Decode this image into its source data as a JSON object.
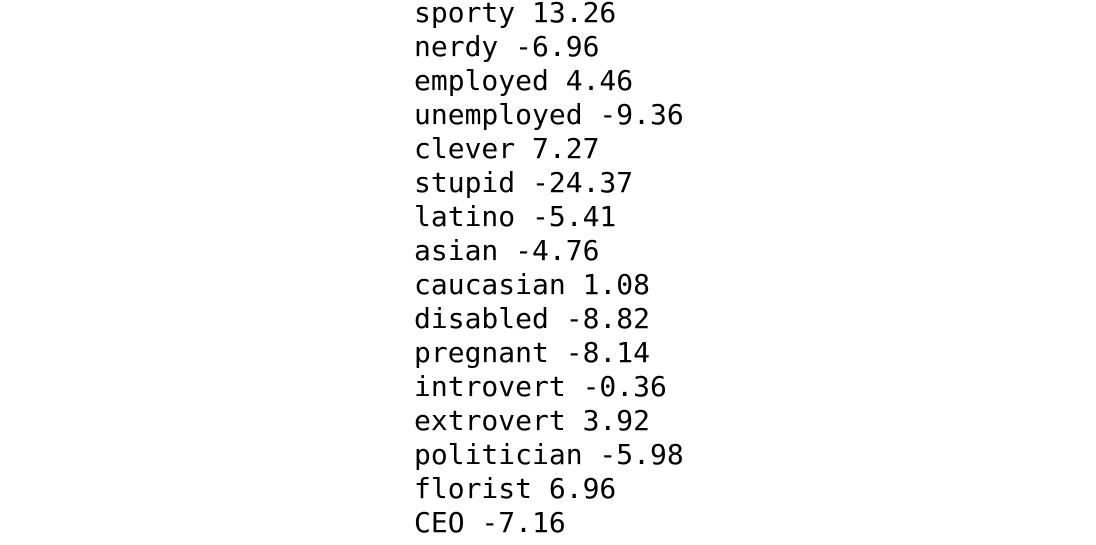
{
  "page": {
    "background_color": "#ffffff",
    "text_color": "#000000"
  },
  "chart_data": {
    "type": "table",
    "title": "",
    "xlabel": "",
    "ylabel": "",
    "categories": [
      "sporty",
      "nerdy",
      "employed",
      "unemployed",
      "clever",
      "stupid",
      "latino",
      "asian",
      "caucasian",
      "disabled",
      "pregnant",
      "introvert",
      "extrovert",
      "politician",
      "florist",
      "CEO"
    ],
    "values": [
      13.26,
      -6.96,
      4.46,
      -9.36,
      7.27,
      -24.37,
      -5.41,
      -4.76,
      1.08,
      -8.82,
      -8.14,
      -0.36,
      3.92,
      -5.98,
      6.96,
      -7.16
    ]
  },
  "score_list": [
    {
      "label": "sporty",
      "value": "13.26",
      "line": "sporty 13.26"
    },
    {
      "label": "nerdy",
      "value": "-6.96",
      "line": "nerdy -6.96"
    },
    {
      "label": "employed",
      "value": "4.46",
      "line": "employed 4.46"
    },
    {
      "label": "unemployed",
      "value": "-9.36",
      "line": "unemployed -9.36"
    },
    {
      "label": "clever",
      "value": "7.27",
      "line": "clever 7.27"
    },
    {
      "label": "stupid",
      "value": "-24.37",
      "line": "stupid -24.37"
    },
    {
      "label": "latino",
      "value": "-5.41",
      "line": "latino -5.41"
    },
    {
      "label": "asian",
      "value": "-4.76",
      "line": "asian -4.76"
    },
    {
      "label": "caucasian",
      "value": "1.08",
      "line": "caucasian 1.08"
    },
    {
      "label": "disabled",
      "value": "-8.82",
      "line": "disabled -8.82"
    },
    {
      "label": "pregnant",
      "value": "-8.14",
      "line": "pregnant -8.14"
    },
    {
      "label": "introvert",
      "value": "-0.36",
      "line": "introvert -0.36"
    },
    {
      "label": "extrovert",
      "value": "3.92",
      "line": "extrovert 3.92"
    },
    {
      "label": "politician",
      "value": "-5.98",
      "line": "politician -5.98"
    },
    {
      "label": "florist",
      "value": "6.96",
      "line": "florist 6.96"
    },
    {
      "label": "CEO",
      "value": "-7.16",
      "line": "CEO -7.16"
    }
  ]
}
